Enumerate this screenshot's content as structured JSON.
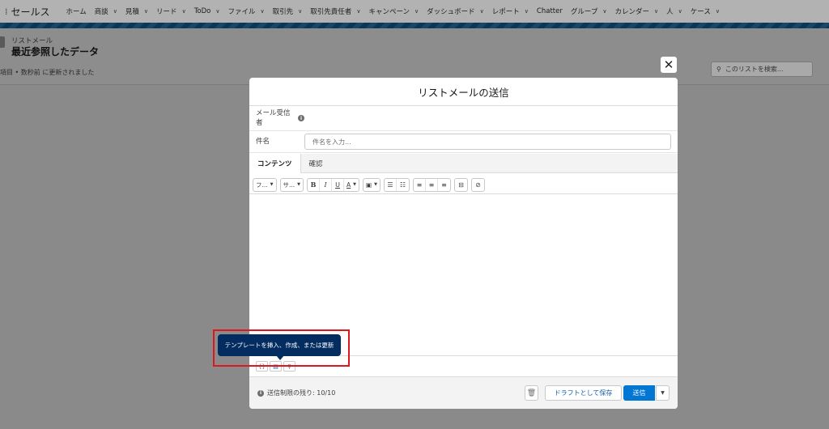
{
  "app": {
    "name": "セールス"
  },
  "nav": {
    "items": [
      {
        "label": "ホーム",
        "chevron": false
      },
      {
        "label": "商談",
        "chevron": true
      },
      {
        "label": "見積",
        "chevron": true
      },
      {
        "label": "リード",
        "chevron": true
      },
      {
        "label": "ToDo",
        "chevron": true
      },
      {
        "label": "ファイル",
        "chevron": true
      },
      {
        "label": "取引先",
        "chevron": true
      },
      {
        "label": "取引先責任者",
        "chevron": true
      },
      {
        "label": "キャンペーン",
        "chevron": true
      },
      {
        "label": "ダッシュボード",
        "chevron": true
      },
      {
        "label": "レポート",
        "chevron": true
      },
      {
        "label": "Chatter",
        "chevron": false
      },
      {
        "label": "グループ",
        "chevron": true
      },
      {
        "label": "カレンダー",
        "chevron": true
      },
      {
        "label": "人",
        "chevron": true
      },
      {
        "label": "ケース",
        "chevron": true
      }
    ]
  },
  "list_view": {
    "object_label": "リストメール",
    "title": "最近参照したデータ",
    "meta": "項目 • 数秒前 に更新されました",
    "search_placeholder": "このリストを検索..."
  },
  "modal": {
    "title": "リストメールの送信",
    "recipient_label": "メール受信者",
    "subject_label": "件名",
    "subject_placeholder": "件名を入力...",
    "subject_value": "",
    "tabs": [
      {
        "label": "コンテンツ",
        "active": true
      },
      {
        "label": "確認",
        "active": false
      }
    ],
    "toolbar": {
      "font_family": "フ...",
      "font_size": "サ...",
      "bold": "B",
      "italic": "I",
      "underline": "U",
      "text_color": "A"
    },
    "footer": {
      "quota": "送信制限の残り: 10/10",
      "draft_button": "ドラフトとして保存",
      "send_button": "送信"
    }
  },
  "tooltip": {
    "text": "テンプレートを挿入、作成、または更新"
  },
  "colors": {
    "brand": "#0176d3",
    "tooltip_bg": "#032d60",
    "highlight": "#e0161d"
  }
}
